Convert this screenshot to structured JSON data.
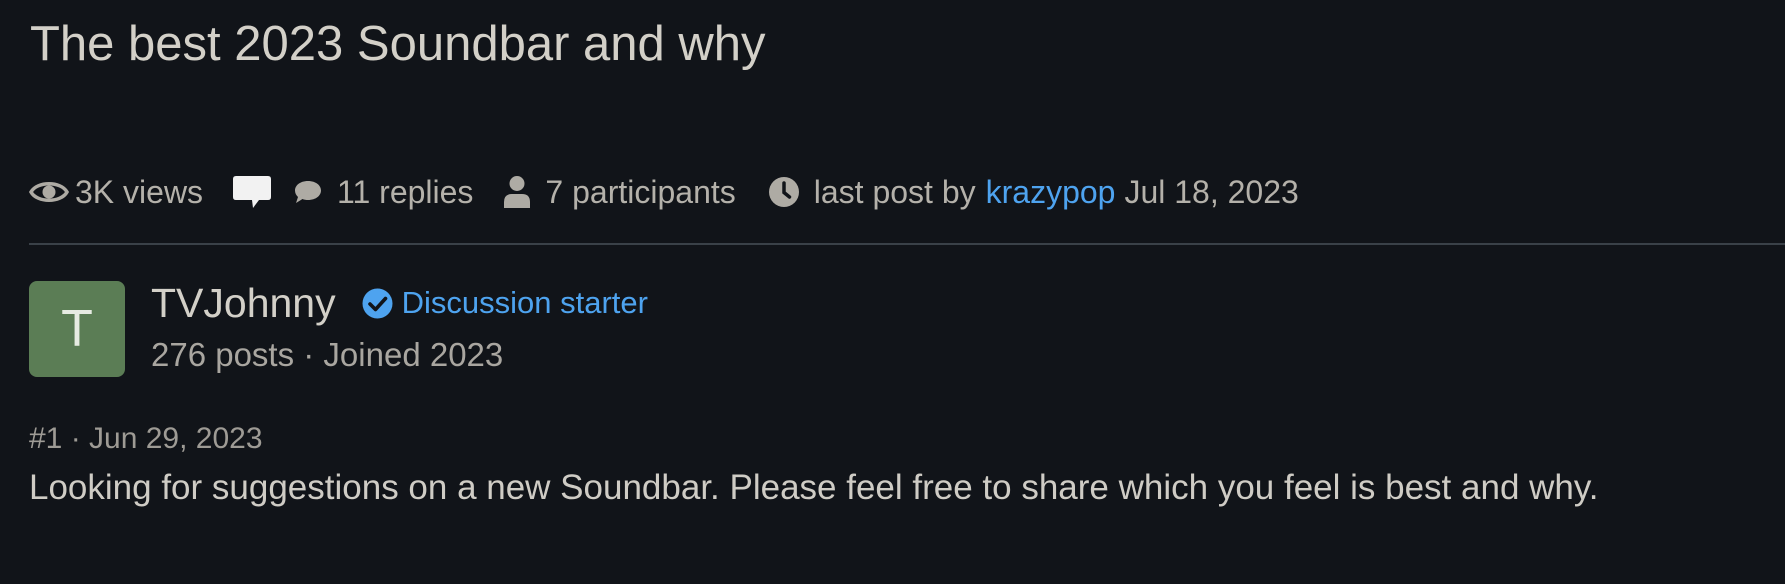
{
  "thread": {
    "title": "The best 2023 Soundbar and why"
  },
  "meta": {
    "views": "3K views",
    "replies": "11 replies",
    "participants": "7 participants",
    "last_post_prefix": "last post by",
    "last_post_user": "krazypop",
    "last_post_date": "Jul 18, 2023"
  },
  "post": {
    "avatar_letter": "T",
    "username": "TVJohnny",
    "badge": "Discussion starter",
    "author_stats": "276 posts · Joined 2023",
    "meta": "#1 · Jun 29, 2023",
    "body": "Looking for suggestions on a new Soundbar. Please feel free to share which you feel is best and why."
  },
  "colors": {
    "background": "#111419",
    "link": "#4ea3ef",
    "avatar": "#5b7d55",
    "divider": "#3a4148"
  },
  "icons": [
    "eye-icon",
    "speech-bubble-icon",
    "chat-icon",
    "person-icon",
    "clock-icon",
    "verified-check-icon"
  ]
}
